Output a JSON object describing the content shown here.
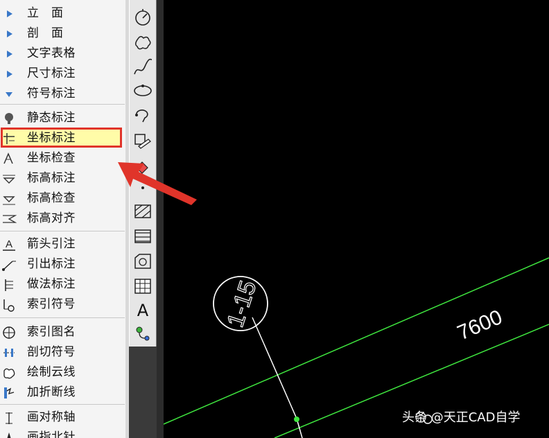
{
  "menu": {
    "items": [
      {
        "label": "立　面",
        "icon": "triangle-right-icon"
      },
      {
        "label": "剖　面",
        "icon": "triangle-right-icon"
      },
      {
        "label": "文字表格",
        "icon": "triangle-right-icon"
      },
      {
        "label": "尺寸标注",
        "icon": "triangle-right-icon"
      },
      {
        "label": "符号标注",
        "icon": "triangle-down-icon"
      },
      {
        "label": "静态标注",
        "icon": "bulb-icon"
      },
      {
        "label": "坐标标注",
        "icon": "coordinate-label-icon"
      },
      {
        "label": "坐标检查",
        "icon": "coordinate-check-icon"
      },
      {
        "label": "标高标注",
        "icon": "elevation-label-icon"
      },
      {
        "label": "标高检查",
        "icon": "elevation-check-icon"
      },
      {
        "label": "标高对齐",
        "icon": "elevation-align-icon"
      },
      {
        "label": "箭头引注",
        "icon": "arrow-leader-icon"
      },
      {
        "label": "引出标注",
        "icon": "leader-label-icon"
      },
      {
        "label": "做法标注",
        "icon": "method-label-icon"
      },
      {
        "label": "索引符号",
        "icon": "index-symbol-icon"
      },
      {
        "label": "索引图名",
        "icon": "index-title-icon"
      },
      {
        "label": "剖切符号",
        "icon": "section-symbol-icon"
      },
      {
        "label": "绘制云线",
        "icon": "cloud-line-icon"
      },
      {
        "label": "加折断线",
        "icon": "break-line-icon"
      },
      {
        "label": "画对称轴",
        "icon": "symmetry-axis-icon"
      },
      {
        "label": "画指北针",
        "icon": "north-arrow-icon"
      }
    ]
  },
  "toolbar": {
    "buttons": [
      "dial-icon",
      "cloud-icon",
      "spline-icon",
      "ellipse-icon",
      "revcloud-icon",
      "edit-icon",
      "erase-icon",
      "dot-icon",
      "hatch-icon",
      "hatch-edit-icon",
      "boundary-icon",
      "table-icon",
      "text-icon",
      "attribute-icon"
    ],
    "text_button_label": "A"
  },
  "drawing": {
    "index_label": "1-15",
    "dimension_text": "7600",
    "colors": {
      "line": "#3fe63f",
      "stroke": "#ffffff",
      "arrow": "#e0342a"
    }
  },
  "watermark": {
    "text": "头条 @天正CAD自学"
  }
}
